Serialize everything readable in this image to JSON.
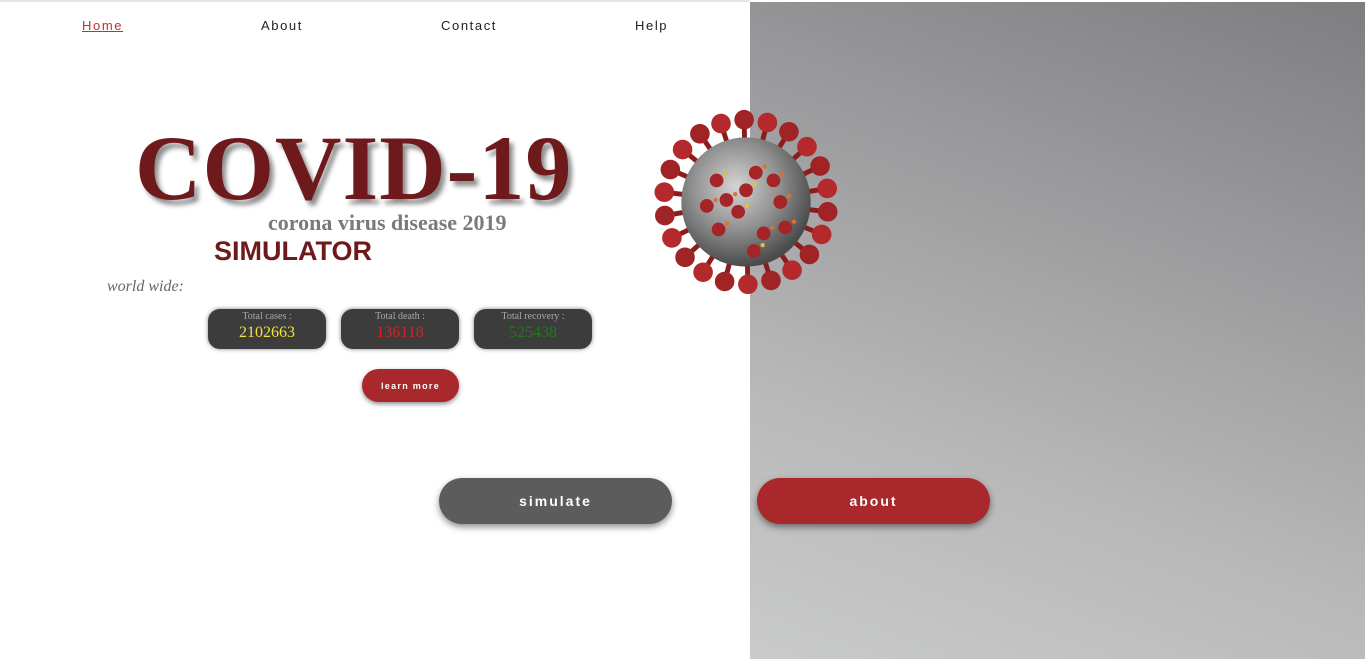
{
  "nav": {
    "items": [
      {
        "label": "Home"
      },
      {
        "label": "About"
      },
      {
        "label": "Contact"
      },
      {
        "label": "Help"
      }
    ]
  },
  "hero": {
    "title": "COVID-19",
    "subtitle": "corona virus disease 2019",
    "tagline": "SIMULATOR",
    "scope_label": "world wide:"
  },
  "stats": {
    "cases": {
      "label": "Total cases :",
      "value": "2102663",
      "color": "#f2e23a"
    },
    "deaths": {
      "label": "Total death :",
      "value": "136118",
      "color": "#e02020"
    },
    "recovery": {
      "label": "Total recovery :",
      "value": "525438",
      "color": "#1f7a1f"
    }
  },
  "buttons": {
    "learn_more": "learn more",
    "simulate": "simulate",
    "about": "about"
  },
  "icons": {
    "virus": "coronavirus-illustration"
  },
  "colors": {
    "brand": "#6e1a1c",
    "accent": "#a8282b",
    "active_link": "#c0302e"
  }
}
